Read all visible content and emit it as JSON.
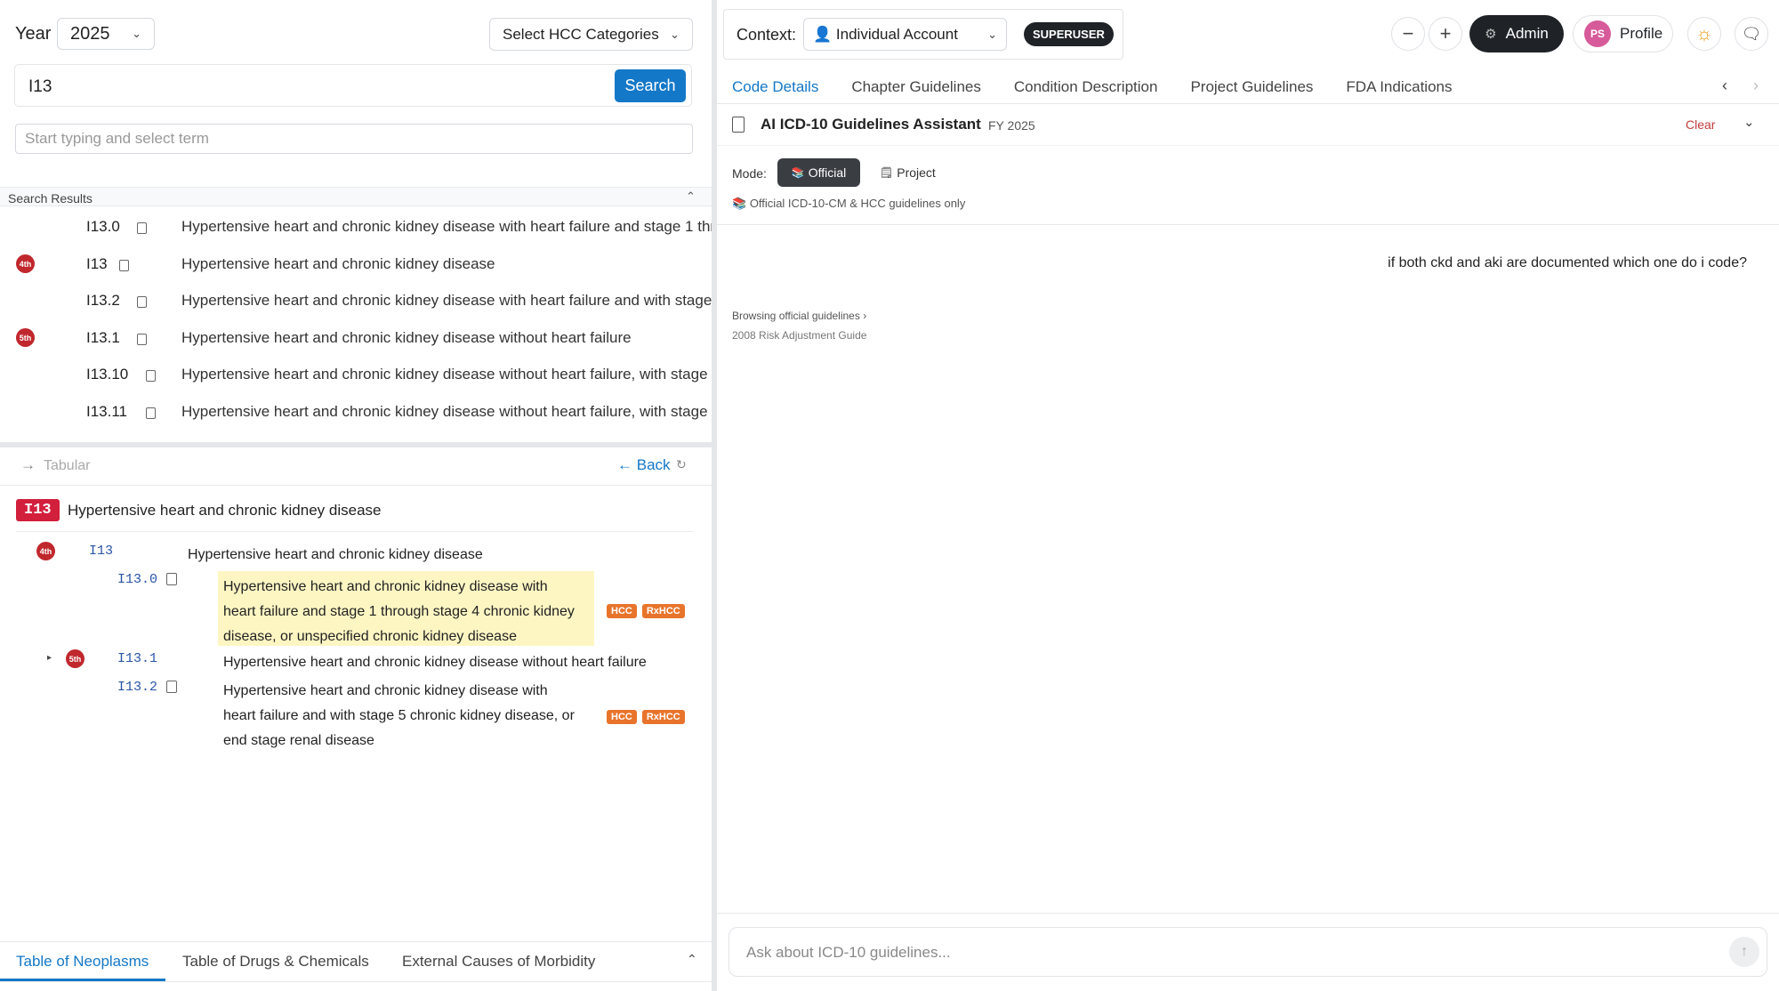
{
  "filters": {
    "year_label": "Year",
    "year_value": "2025",
    "hcc_select": "Select HCC Categories"
  },
  "search": {
    "value": "I13",
    "button": "Search",
    "term_placeholder": "Start typing and select term"
  },
  "results": {
    "title": "Search Results",
    "rows": [
      {
        "code": "I13.0",
        "desc": "Hypertensive heart and chronic kidney disease with heart failure and stage 1 thr",
        "badge": ""
      },
      {
        "code": "I13",
        "desc": "Hypertensive heart and chronic kidney disease",
        "badge": "4th"
      },
      {
        "code": "I13.2",
        "desc": "Hypertensive heart and chronic kidney disease with heart failure and with stage",
        "badge": ""
      },
      {
        "code": "I13.1",
        "desc": "Hypertensive heart and chronic kidney disease without heart failure",
        "badge": "5th"
      },
      {
        "code": "I13.10",
        "desc": "Hypertensive heart and chronic kidney disease without heart failure, with stage",
        "badge": ""
      },
      {
        "code": "I13.11",
        "desc": "Hypertensive heart and chronic kidney disease without heart failure, with stage",
        "badge": ""
      }
    ]
  },
  "tabular": {
    "label": "Tabular",
    "back": "Back",
    "code_chip": "I13",
    "title": "Hypertensive heart and chronic kidney disease",
    "root": {
      "badge": "4th",
      "code": "I13",
      "desc": "Hypertensive heart and chronic kidney disease"
    },
    "items": [
      {
        "code": "I13.0",
        "lines": [
          "Hypertensive heart and chronic kidney disease with",
          "heart failure and stage 1 through stage 4 chronic kidney",
          "disease, or unspecified chronic kidney disease"
        ],
        "tags": [
          "HCC",
          "RxHCC"
        ]
      },
      {
        "code": "I13.1",
        "badge": "5th",
        "lines": [
          "Hypertensive heart and chronic kidney disease without heart failure"
        ],
        "tags": []
      },
      {
        "code": "I13.2",
        "lines": [
          "Hypertensive heart and chronic kidney disease with",
          "heart failure and with stage 5 chronic kidney disease, or",
          "end stage renal disease"
        ],
        "tags": [
          "HCC",
          "RxHCC"
        ]
      }
    ]
  },
  "bottom_tabs": [
    "Table of Neoplasms",
    "Table of Drugs & Chemicals",
    "External Causes of Morbidity"
  ],
  "header": {
    "context_label": "Context:",
    "context_value": "Individual Account",
    "role_badge": "SUPERUSER",
    "admin": "Admin",
    "profile_initials": "PS",
    "profile": "Profile"
  },
  "tabs": [
    "Code Details",
    "Chapter Guidelines",
    "Condition Description",
    "Project Guidelines",
    "FDA Indications"
  ],
  "assistant": {
    "title": "AI ICD-10 Guidelines Assistant",
    "fy": "FY 2025",
    "clear": "Clear",
    "mode_label": "Mode:",
    "mode_official": "Official",
    "mode_project": "Project",
    "mode_note": "Official ICD-10-CM & HCC guidelines only",
    "user_msg": "if both ckd and aki are documented which one do i code?",
    "browsing": "Browsing official guidelines",
    "source": "2008 Risk Adjustment Guide",
    "input_placeholder": "Ask about ICD-10 guidelines..."
  },
  "colors": {
    "accent": "#1478c8",
    "badge_red": "#c0282d",
    "tag_orange": "#e8742c",
    "highlight": "#fdf6c3",
    "admin_bg": "#1f2328"
  }
}
